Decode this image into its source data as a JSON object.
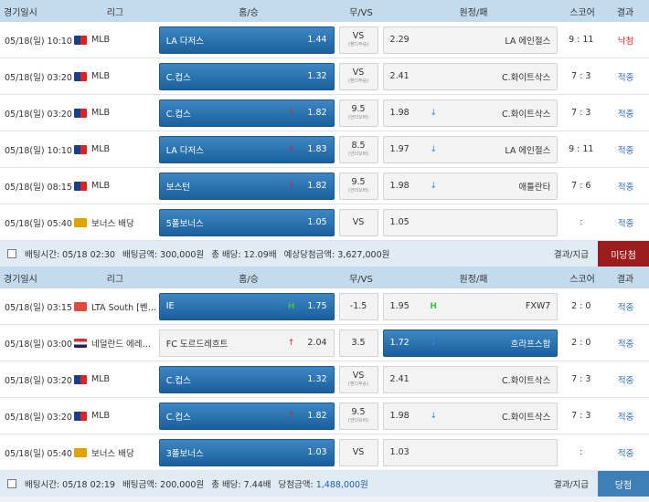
{
  "header": {
    "date": "경기일시",
    "league": "리그",
    "home": "홈/승",
    "vs": "무/VS",
    "away": "원정/패",
    "score": "스코어",
    "result": "결과"
  },
  "slips": [
    {
      "rows": [
        {
          "date": "05/18(일) 10:10",
          "flag": "mlb",
          "league": "MLB",
          "home": "LA 다저스",
          "home_odd": "1.44",
          "home_ind": "",
          "home_sel": true,
          "vs": "VS",
          "vs_sub": "(핸디무승)",
          "away": "LA 에인절스",
          "away_odd": "2.29",
          "away_ind": "",
          "away_sel": false,
          "score": "9 : 11",
          "result": "낙첨",
          "result_type": "miss"
        },
        {
          "date": "05/18(일) 03:20",
          "flag": "mlb",
          "league": "MLB",
          "home": "C.컵스",
          "home_odd": "1.32",
          "home_ind": "",
          "home_sel": true,
          "vs": "VS",
          "vs_sub": "(핸디무승)",
          "away": "C.화이트삭스",
          "away_odd": "2.41",
          "away_ind": "",
          "away_sel": false,
          "score": "7 : 3",
          "result": "적중",
          "result_type": "hit"
        },
        {
          "date": "05/18(일) 03:20",
          "flag": "mlb",
          "league": "MLB",
          "home": "C.컵스",
          "home_odd": "1.82",
          "home_ind": "↑",
          "home_ind_type": "up",
          "home_sel": true,
          "vs": "9.5",
          "vs_sub": "(언더오버)",
          "away": "C.화이트삭스",
          "away_odd": "1.98",
          "away_ind": "↓",
          "away_ind_type": "down",
          "away_sel": false,
          "score": "7 : 3",
          "result": "적중",
          "result_type": "hit"
        },
        {
          "date": "05/18(일) 10:10",
          "flag": "mlb",
          "league": "MLB",
          "home": "LA 다저스",
          "home_odd": "1.83",
          "home_ind": "↑",
          "home_ind_type": "up",
          "home_sel": true,
          "vs": "8.5",
          "vs_sub": "(언더오버)",
          "away": "LA 에인절스",
          "away_odd": "1.97",
          "away_ind": "↓",
          "away_ind_type": "down",
          "away_sel": false,
          "score": "9 : 11",
          "result": "적중",
          "result_type": "hit"
        },
        {
          "date": "05/18(일) 08:15",
          "flag": "mlb",
          "league": "MLB",
          "home": "보스턴",
          "home_odd": "1.82",
          "home_ind": "↑",
          "home_ind_type": "up",
          "home_sel": true,
          "vs": "9.5",
          "vs_sub": "(언더오버)",
          "away": "애틀란타",
          "away_odd": "1.98",
          "away_ind": "↓",
          "away_ind_type": "down",
          "away_sel": false,
          "score": "7 : 6",
          "result": "적중",
          "result_type": "hit"
        },
        {
          "date": "05/18(일) 05:40",
          "flag": "bonus",
          "league": "보너스 배당",
          "home": "5폴보너스",
          "home_odd": "1.05",
          "home_ind": "",
          "home_sel": true,
          "vs": "VS",
          "vs_sub": "",
          "away": "",
          "away_odd": "1.05",
          "away_ind": "",
          "away_sel": false,
          "score": ":",
          "result": "적중",
          "result_type": "hit"
        }
      ],
      "footer": {
        "time": "배팅시간: 05/18 02:30",
        "amount": "배팅금액: 300,000원",
        "total": "총 배당: 12.09배",
        "win_label": "예상당첨금액: ",
        "win_value": "3,627,000원",
        "pay": "결과/지급",
        "status": "미당첨",
        "status_type": "miss"
      }
    },
    {
      "rows": [
        {
          "date": "05/18(일) 03:15",
          "flag": "lta",
          "league": "LTA South [벤픽…",
          "home": "IE",
          "home_odd": "1.75",
          "home_ind": "H",
          "home_ind_type": "h",
          "home_sel": true,
          "vs": "-1.5",
          "vs_sub": "",
          "away": "FXW7",
          "away_odd": "1.95",
          "away_ind": "H",
          "away_ind_type": "h",
          "away_sel": false,
          "score": "2 : 0",
          "result": "적중",
          "result_type": "hit"
        },
        {
          "date": "05/18(일) 03:00",
          "flag": "nl",
          "league": "네덜란드 에레디…",
          "home": "FC 도르드레흐트",
          "home_odd": "2.04",
          "home_ind": "↑",
          "home_ind_type": "up",
          "home_sel": false,
          "vs": "3.5",
          "vs_sub": "",
          "away": "흐라프스합",
          "away_odd": "1.72",
          "away_ind": "↓",
          "away_ind_type": "down",
          "away_sel": true,
          "score": "2 : 0",
          "result": "적중",
          "result_type": "hit"
        },
        {
          "date": "05/18(일) 03:20",
          "flag": "mlb",
          "league": "MLB",
          "home": "C.컵스",
          "home_odd": "1.32",
          "home_ind": "",
          "home_sel": true,
          "vs": "VS",
          "vs_sub": "(핸디무승)",
          "away": "C.화이트삭스",
          "away_odd": "2.41",
          "away_ind": "",
          "away_sel": false,
          "score": "7 : 3",
          "result": "적중",
          "result_type": "hit"
        },
        {
          "date": "05/18(일) 03:20",
          "flag": "mlb",
          "league": "MLB",
          "home": "C.컵스",
          "home_odd": "1.82",
          "home_ind": "↑",
          "home_ind_type": "up",
          "home_sel": true,
          "vs": "9.5",
          "vs_sub": "(언더오버)",
          "away": "C.화이트삭스",
          "away_odd": "1.98",
          "away_ind": "↓",
          "away_ind_type": "down",
          "away_sel": false,
          "score": "7 : 3",
          "result": "적중",
          "result_type": "hit"
        },
        {
          "date": "05/18(일) 05:40",
          "flag": "bonus",
          "league": "보너스 배당",
          "home": "3폴보너스",
          "home_odd": "1.03",
          "home_ind": "",
          "home_sel": true,
          "vs": "VS",
          "vs_sub": "",
          "away": "",
          "away_odd": "1.03",
          "away_ind": "",
          "away_sel": false,
          "score": ":",
          "result": "적중",
          "result_type": "hit"
        }
      ],
      "footer": {
        "time": "배팅시간: 05/18 02:19",
        "amount": "배팅금액: 200,000원",
        "total": "총 배당: 7.44배",
        "win_label": "당첨금액: ",
        "win_value": "1,488,000원",
        "pay": "결과/지급",
        "status": "당첨",
        "status_type": "win"
      }
    }
  ],
  "colors": {
    "header_bg": "#c4dbee",
    "selected": "#1b5f9e",
    "hit": "#2a6ab8",
    "miss": "#e02020",
    "badge_miss": "#9b1c1c",
    "badge_win": "#3f7fb8"
  }
}
